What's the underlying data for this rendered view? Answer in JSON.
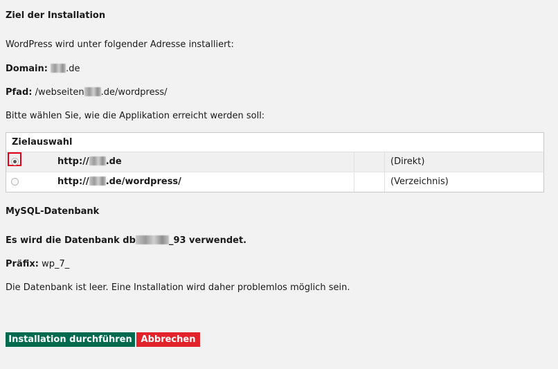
{
  "section1": {
    "title": "Ziel der Installation"
  },
  "intro_text": "WordPress wird unter folgender Adresse installiert:",
  "domain": {
    "label": "Domain:",
    "suffix": ".de"
  },
  "pfad": {
    "label": "Pfad:",
    "prefix": "/webseiten",
    "suffix": ".de/wordpress/"
  },
  "choose_text": "Bitte wählen Sie, wie die Applikation erreicht werden soll:",
  "table": {
    "header": "Zielauswahl",
    "rows": [
      {
        "url_prefix": "http://",
        "url_suffix": ".de",
        "type": "(Direkt)",
        "selected": true
      },
      {
        "url_prefix": "http://",
        "url_suffix": ".de/wordpress/",
        "type": "(Verzeichnis)",
        "selected": false
      }
    ]
  },
  "section2": {
    "title": "MySQL-Datenbank"
  },
  "db_text": {
    "prefix": "Es wird die Datenbank db",
    "suffix": "_93 verwendet."
  },
  "prefix_field": {
    "label": "Präfix:",
    "value": "wp_7_"
  },
  "empty_text": "Die Datenbank ist leer. Eine Installation wird daher problemlos möglich sein.",
  "buttons": {
    "install": "Installation durchführen",
    "cancel": "Abbrechen"
  },
  "colors": {
    "install_bg": "#006a4e",
    "cancel_bg": "#e3232b",
    "highlight": "#e3001b",
    "page_bg": "#f2f2f2"
  }
}
